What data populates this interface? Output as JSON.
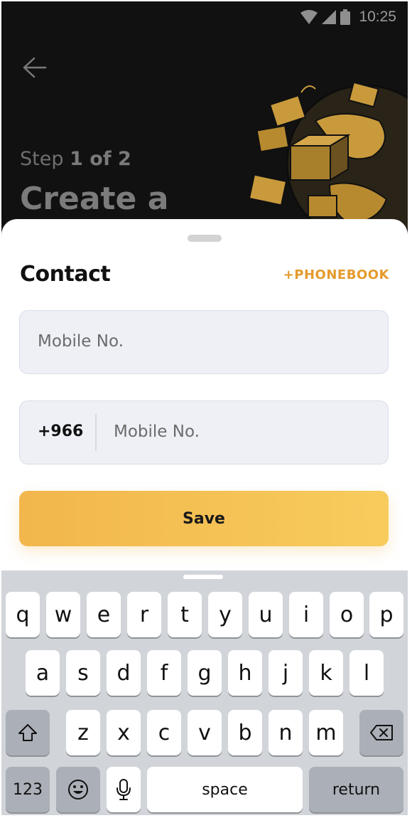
{
  "status_bar": {
    "time": "10:25"
  },
  "header": {
    "step_prefix": "Step",
    "step_value": "1 of 2",
    "title": "Create a"
  },
  "sheet": {
    "title": "Contact",
    "phonebook_label": "+PHONEBOOK",
    "mobile_placeholder": "Mobile No.",
    "country_code": "+966",
    "mobile_placeholder_2": "Mobile No.",
    "save_label": "Save"
  },
  "keyboard": {
    "row1": [
      "q",
      "w",
      "e",
      "r",
      "t",
      "y",
      "u",
      "i",
      "o",
      "p"
    ],
    "row2": [
      "a",
      "s",
      "d",
      "f",
      "g",
      "h",
      "j",
      "k",
      "l"
    ],
    "row3": [
      "z",
      "x",
      "c",
      "v",
      "b",
      "n",
      "m"
    ],
    "numbers_label": "123",
    "space_label": "space",
    "return_label": "return"
  },
  "colors": {
    "accent": "#e59a2c",
    "save_gradient_start": "#f2b64c",
    "save_gradient_end": "#f7cc5d"
  }
}
